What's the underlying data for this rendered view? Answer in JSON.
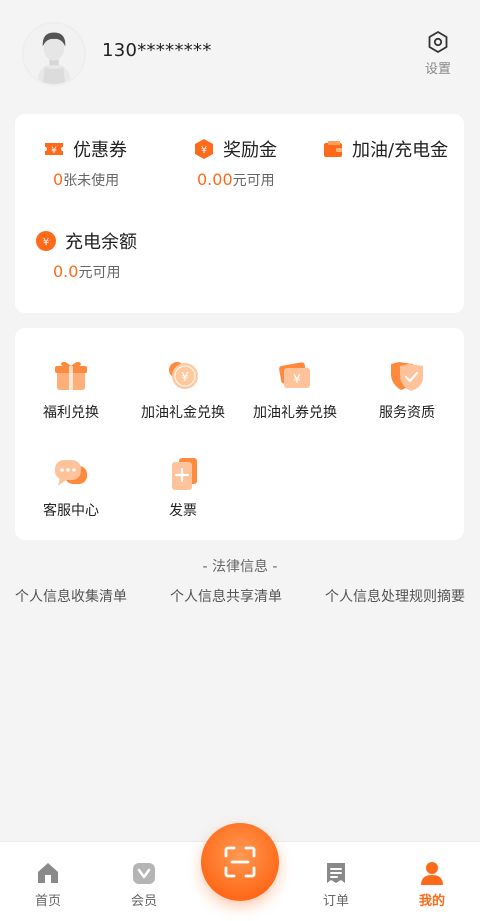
{
  "header": {
    "phone": "130********",
    "settings_label": "设置"
  },
  "assets": [
    {
      "title": "优惠券",
      "value": "0",
      "unit": "张未使用",
      "icon": "ticket-icon"
    },
    {
      "title": "奖励金",
      "value": "0.00",
      "unit": "元可用",
      "icon": "hex-coin-icon"
    },
    {
      "title": "加油/充电金",
      "value": "",
      "unit": "",
      "icon": "wallet-icon"
    },
    {
      "title": "充电余额",
      "value": "0.0",
      "unit": "元可用",
      "icon": "coin-icon"
    }
  ],
  "services": [
    {
      "label": "福利兑换",
      "icon": "gift-icon"
    },
    {
      "label": "加油礼金兑换",
      "icon": "coin-exchange-icon"
    },
    {
      "label": "加油礼券兑换",
      "icon": "voucher-exchange-icon"
    },
    {
      "label": "服务资质",
      "icon": "shield-check-icon"
    },
    {
      "label": "客服中心",
      "icon": "chat-bubble-icon"
    },
    {
      "label": "发票",
      "icon": "invoice-icon"
    }
  ],
  "legal": {
    "title": "- 法律信息 -",
    "links": [
      "个人信息收集清单",
      "个人信息共享清单",
      "个人信息处理规则摘要"
    ]
  },
  "nav": {
    "items": [
      {
        "label": "首页",
        "icon": "home-icon"
      },
      {
        "label": "会员",
        "icon": "member-icon"
      },
      {
        "label": "订单",
        "icon": "order-icon"
      },
      {
        "label": "我的",
        "icon": "profile-icon"
      }
    ],
    "scan_icon": "scan-icon"
  },
  "colors": {
    "accent": "#ff6a1a",
    "background": "#f4f4f4",
    "card": "#ffffff"
  }
}
